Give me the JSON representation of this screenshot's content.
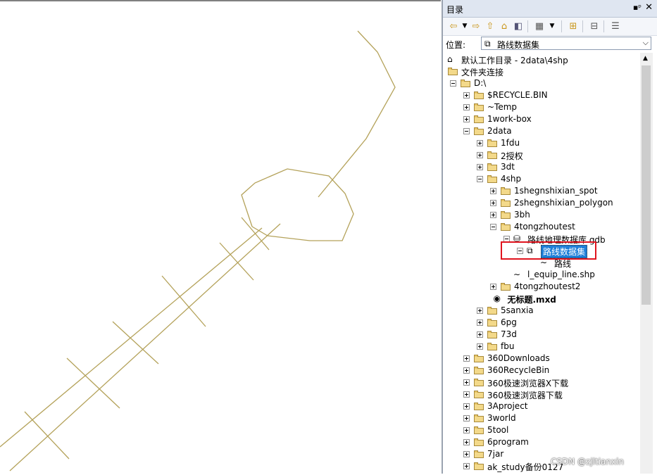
{
  "catalog": {
    "title": "目录",
    "pin": "ᵖ",
    "close": "✕",
    "location_label": "位置:",
    "location_value": "路线数据集",
    "toolbar_icons": [
      "back-arrow-icon",
      "dropdown-icon",
      "forward-arrow-icon",
      "up-folder-icon",
      "home-icon",
      "connect-icon",
      "view-grid-icon",
      "dropdown-icon",
      "new-item-icon",
      "tree-view-icon",
      "details-icon"
    ]
  },
  "tree": [
    {
      "label": "默认工作目录 - 2data\\4shp",
      "depth": 0,
      "expander": "none",
      "icon": "home-folder",
      "bold": false
    },
    {
      "label": "文件夹连接",
      "depth": 0,
      "expander": "none",
      "icon": "folder-connection",
      "bold": false
    },
    {
      "label": "D:\\",
      "depth": 1,
      "expander": "minus",
      "icon": "folder",
      "bold": false
    },
    {
      "label": "$RECYCLE.BIN",
      "depth": 2,
      "expander": "plus",
      "icon": "folder",
      "bold": false
    },
    {
      "label": "~Temp",
      "depth": 2,
      "expander": "plus",
      "icon": "folder",
      "bold": false
    },
    {
      "label": "1work-box",
      "depth": 2,
      "expander": "plus",
      "icon": "folder",
      "bold": false
    },
    {
      "label": "2data",
      "depth": 2,
      "expander": "minus",
      "icon": "folder",
      "bold": false
    },
    {
      "label": "1fdu",
      "depth": 3,
      "expander": "plus",
      "icon": "folder",
      "bold": false
    },
    {
      "label": "2授权",
      "depth": 3,
      "expander": "plus",
      "icon": "folder",
      "bold": false
    },
    {
      "label": "3dt",
      "depth": 3,
      "expander": "plus",
      "icon": "folder",
      "bold": false
    },
    {
      "label": "4shp",
      "depth": 3,
      "expander": "minus",
      "icon": "folder",
      "bold": false
    },
    {
      "label": "1shegnshixian_spot",
      "depth": 4,
      "expander": "plus",
      "icon": "folder",
      "bold": false
    },
    {
      "label": "2shegnshixian_polygon",
      "depth": 4,
      "expander": "plus",
      "icon": "folder",
      "bold": false
    },
    {
      "label": "3bh",
      "depth": 4,
      "expander": "plus",
      "icon": "folder",
      "bold": false
    },
    {
      "label": "4tongzhoutest",
      "depth": 4,
      "expander": "minus",
      "icon": "folder",
      "bold": false
    },
    {
      "label": "路线地理数据库.gdb",
      "depth": 5,
      "expander": "minus",
      "icon": "gdb",
      "bold": false
    },
    {
      "label": "路线数据集",
      "depth": 6,
      "expander": "minus",
      "icon": "dataset",
      "bold": false,
      "selected": true
    },
    {
      "label": "路线",
      "depth": 7,
      "expander": "none",
      "icon": "line-fc",
      "bold": false
    },
    {
      "label": "l_equip_line.shp",
      "depth": 5,
      "expander": "none",
      "icon": "line-shp",
      "bold": false
    },
    {
      "label": "4tongzhoutest2",
      "depth": 4,
      "expander": "plus",
      "icon": "folder",
      "bold": false
    },
    {
      "label": "无标题.mxd",
      "depth": 3.5,
      "expander": "none",
      "icon": "mxd",
      "bold": true
    },
    {
      "label": "5sanxia",
      "depth": 3,
      "expander": "plus",
      "icon": "folder",
      "bold": false
    },
    {
      "label": "6pg",
      "depth": 3,
      "expander": "plus",
      "icon": "folder",
      "bold": false
    },
    {
      "label": "73d",
      "depth": 3,
      "expander": "plus",
      "icon": "folder",
      "bold": false
    },
    {
      "label": "fbu",
      "depth": 3,
      "expander": "plus",
      "icon": "folder",
      "bold": false
    },
    {
      "label": "360Downloads",
      "depth": 2,
      "expander": "plus",
      "icon": "folder",
      "bold": false
    },
    {
      "label": "360RecycleBin",
      "depth": 2,
      "expander": "plus",
      "icon": "folder",
      "bold": false
    },
    {
      "label": "360极速浏览器X下载",
      "depth": 2,
      "expander": "plus",
      "icon": "folder",
      "bold": false
    },
    {
      "label": "360极速浏览器下载",
      "depth": 2,
      "expander": "plus",
      "icon": "folder",
      "bold": false
    },
    {
      "label": "3Aproject",
      "depth": 2,
      "expander": "plus",
      "icon": "folder",
      "bold": false
    },
    {
      "label": "3world",
      "depth": 2,
      "expander": "plus",
      "icon": "folder",
      "bold": false
    },
    {
      "label": "5tool",
      "depth": 2,
      "expander": "plus",
      "icon": "folder",
      "bold": false
    },
    {
      "label": "6program",
      "depth": 2,
      "expander": "plus",
      "icon": "folder",
      "bold": false
    },
    {
      "label": "7jar",
      "depth": 2,
      "expander": "plus",
      "icon": "folder",
      "bold": false
    },
    {
      "label": "ak_study备份0127",
      "depth": 2,
      "expander": "plus",
      "icon": "folder",
      "bold": false
    }
  ],
  "watermark": "CSDN @zjltianxin",
  "colors": {
    "map_line": "#b4a25a",
    "selection": "#1e7fd8",
    "highlight_box": "#e0141e"
  }
}
